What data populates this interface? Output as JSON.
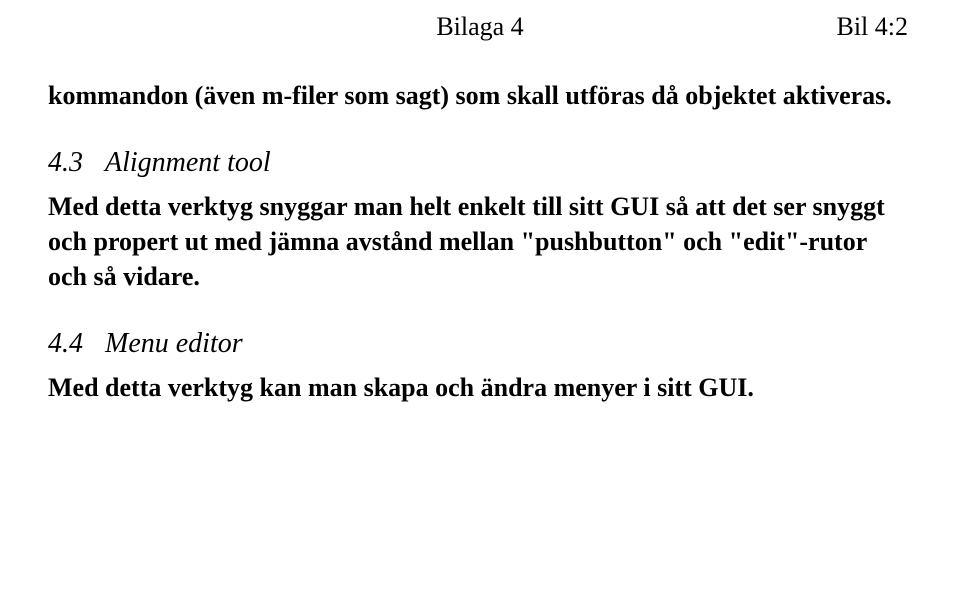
{
  "header": {
    "left": "Bilaga 4",
    "right": "Bil 4:2"
  },
  "intro_paragraph": "kommandon (även m-filer som sagt) som skall utföras då objektet aktiveras.",
  "sections": [
    {
      "number": "4.3",
      "title": "Alignment tool",
      "body": "Med detta verktyg snyggar man helt enkelt till sitt GUI så att det ser snyggt och propert ut med jämna avstånd mellan \"pushbutton\" och \"edit\"-rutor och så vidare."
    },
    {
      "number": "4.4",
      "title": "Menu editor",
      "body": "Med detta verktyg kan man skapa och ändra menyer i sitt GUI."
    }
  ]
}
